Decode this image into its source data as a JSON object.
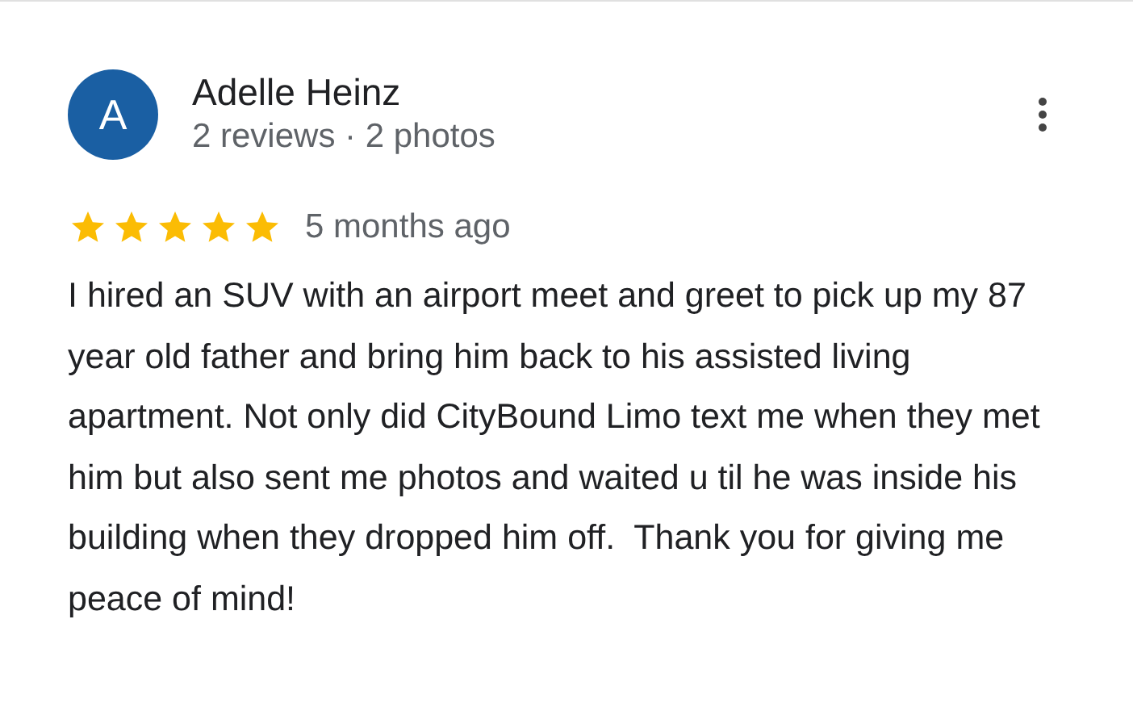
{
  "review": {
    "avatar_letter": "A",
    "author": "Adelle Heinz",
    "meta": "2 reviews · 2 photos",
    "stars": 5,
    "time": "5 months ago",
    "text": "I hired an SUV with an airport meet and greet to pick up my 87 year old father and bring him back to his assisted living apartment. Not only did CityBound Limo text me when they met him but also sent me photos and waited u til he was inside his building when they dropped him off.  Thank you for giving me peace of mind!"
  }
}
